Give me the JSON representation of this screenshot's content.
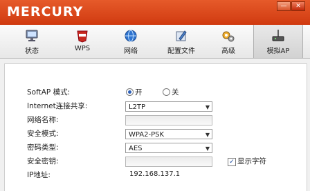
{
  "window": {
    "logo": "MERCURY",
    "minimize_glyph": "—",
    "close_glyph": "✕"
  },
  "tabs": [
    {
      "label": "状态",
      "icon": "monitor-icon"
    },
    {
      "label": "WPS",
      "icon": "wps-badge-icon"
    },
    {
      "label": "网络",
      "icon": "globe-icon"
    },
    {
      "label": "配置文件",
      "icon": "profile-icon"
    },
    {
      "label": "高级",
      "icon": "gears-icon"
    },
    {
      "label": "模拟AP",
      "icon": "router-icon",
      "active": true
    }
  ],
  "form": {
    "softap_label": "SoftAP 模式:",
    "softap_on": "开",
    "softap_off": "关",
    "softap_selected": "开",
    "share_label": "Internet连接共享:",
    "share_value": "L2TP",
    "ssid_label": "网络名称:",
    "ssid_value": "",
    "security_mode_label": "安全模式:",
    "security_mode_value": "WPA2-PSK",
    "cipher_label": "密码类型:",
    "cipher_value": "AES",
    "key_label": "安全密钥:",
    "key_value": "",
    "show_chars_label": "显示字符",
    "show_chars_checked": true,
    "ip_label": "IP地址:",
    "ip_value": "192.168.137.1"
  },
  "colors": {
    "brand": "#d8461a",
    "radio_accent": "#2b5fb8"
  }
}
